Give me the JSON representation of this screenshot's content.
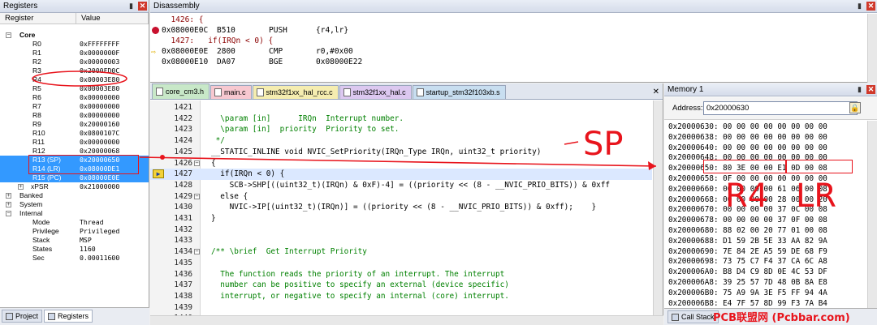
{
  "registers": {
    "title": "Registers",
    "col_register": "Register",
    "col_value": "Value",
    "core_label": "Core",
    "core": [
      {
        "name": "R0",
        "value": "0xFFFFFFFF"
      },
      {
        "name": "R1",
        "value": "0x0000000F"
      },
      {
        "name": "R2",
        "value": "0x00000003"
      },
      {
        "name": "R3",
        "value": "0x2000FD0C"
      },
      {
        "name": "R4",
        "value": "0x00003E80"
      },
      {
        "name": "R5",
        "value": "0x00003E80"
      },
      {
        "name": "R6",
        "value": "0x00000000"
      },
      {
        "name": "R7",
        "value": "0x00000000"
      },
      {
        "name": "R8",
        "value": "0x00000000"
      },
      {
        "name": "R9",
        "value": "0x20000160"
      },
      {
        "name": "R10",
        "value": "0x0800107C"
      },
      {
        "name": "R11",
        "value": "0x00000000"
      },
      {
        "name": "R12",
        "value": "0x20000068"
      },
      {
        "name": "R13 (SP)",
        "value": "0x20000650"
      },
      {
        "name": "R14 (LR)",
        "value": "0x08000DE1"
      },
      {
        "name": "R15 (PC)",
        "value": "0x08000E0E"
      },
      {
        "name": "xPSR",
        "value": "0x21000000"
      }
    ],
    "groups": [
      "Banked",
      "System",
      "Internal"
    ],
    "internal": [
      {
        "name": "Mode",
        "value": "Thread"
      },
      {
        "name": "Privilege",
        "value": "Privileged"
      },
      {
        "name": "Stack",
        "value": "MSP"
      },
      {
        "name": "States",
        "value": "1160"
      },
      {
        "name": "Sec",
        "value": "0.00011600"
      }
    ],
    "bottom_tabs": [
      "Project",
      "Registers"
    ]
  },
  "disassembly": {
    "title": "Disassembly",
    "lines": [
      {
        "src": "  1426: {"
      },
      {
        "addr": "0x08000E0C",
        "code": "B510",
        "mn": "PUSH",
        "ops": "{r4,lr}",
        "bp": true
      },
      {
        "src": "  1427:   if(IRQn < 0) {"
      },
      {
        "addr": "0x08000E0E",
        "code": "2800",
        "mn": "CMP",
        "ops": "r0,#0x00",
        "arrow": true
      },
      {
        "addr": "0x08000E10",
        "code": "DA07",
        "mn": "BGE",
        "ops": "0x08000E22"
      }
    ]
  },
  "editor": {
    "tabs": [
      {
        "label": "core_cm3.h",
        "color": "#c8e8c8",
        "active": true
      },
      {
        "label": "main.c",
        "color": "#f7c8d0"
      },
      {
        "label": "stm32f1xx_hal_rcc.c",
        "color": "#f5edb0"
      },
      {
        "label": "stm32f1xx_hal.c",
        "color": "#dcc8f0"
      },
      {
        "label": "startup_stm32f103xb.s",
        "color": "#c8def0"
      }
    ],
    "lines": [
      {
        "n": "1421",
        "t": ""
      },
      {
        "n": "1422",
        "t": "  \\param [in]      IRQn  Interrupt number.",
        "c": "cmt"
      },
      {
        "n": "1423",
        "t": "  \\param [in]  priority  Priority to set.",
        "c": "cmt"
      },
      {
        "n": "1424",
        "t": " */",
        "c": "cmt"
      },
      {
        "n": "1425",
        "t": "__STATIC_INLINE void NVIC_SetPriority(IRQn_Type IRQn, uint32_t priority)"
      },
      {
        "n": "1426",
        "t": "{",
        "fold": true
      },
      {
        "n": "1427",
        "t": "  if(IRQn < 0) {",
        "cur": true
      },
      {
        "n": "1428",
        "t": "    SCB->SHP[((uint32_t)(IRQn) & 0xF)-4] = ((priority << (8 - __NVIC_PRIO_BITS)) & 0xff"
      },
      {
        "n": "1429",
        "t": "  else {",
        "fold": true
      },
      {
        "n": "1430",
        "t": "    NVIC->IP[(uint32_t)(IRQn)] = ((priority << (8 - __NVIC_PRIO_BITS)) & 0xff);    }"
      },
      {
        "n": "1431",
        "t": "}"
      },
      {
        "n": "1432",
        "t": ""
      },
      {
        "n": "1433",
        "t": ""
      },
      {
        "n": "1434",
        "t": "/** \\brief  Get Interrupt Priority",
        "c": "cmt",
        "fold": true
      },
      {
        "n": "1435",
        "t": ""
      },
      {
        "n": "1436",
        "t": "  The function reads the priority of an interrupt. The interrupt",
        "c": "cmt"
      },
      {
        "n": "1437",
        "t": "  number can be positive to specify an external (device specific)",
        "c": "cmt"
      },
      {
        "n": "1438",
        "t": "  interrupt, or negative to specify an internal (core) interrupt.",
        "c": "cmt"
      },
      {
        "n": "1439",
        "t": ""
      },
      {
        "n": "1440",
        "t": ""
      }
    ]
  },
  "memory": {
    "title": "Memory 1",
    "address_label": "Address:",
    "address_value": "0x20000630",
    "rows": [
      "0x20000630: 00 00 00 00 00 00 00 00",
      "0x20000638: 00 00 00 00 00 00 00 00",
      "0x20000640: 00 00 00 00 00 00 00 00",
      "0x20000648: 00 00 00 00 00 00 00 00",
      "0x20000650: 80 3E 00 00 E1 0D 00 08",
      "0x20000658: 0F 00 00 00 00 00 00 00",
      "0x20000660: 00 00 00 00 61 06 00 08",
      "0x20000668: 00 00 00 00 28 00 00 20",
      "0x20000670: 00 00 00 00 37 0C 00 08",
      "0x20000678: 00 00 00 00 37 0F 00 08",
      "0x20000680: 88 02 00 20 77 01 00 08",
      "0x20000688: D1 59 2B 5E 33 AA 82 9A",
      "0x20000690: 7E 84 2E A5 59 DE 68 F9",
      "0x20000698: 73 75 C7 F4 37 CA 6C A8",
      "0x200006A0: B8 D4 C9 8D 0E 4C 53 DF",
      "0x200006A8: 39 25 57 7D 48 0B 8A E8",
      "0x200006B0: 75 A9 9A 3E F5 FF 94 4A",
      "0x200006B8: E4 7F 57 8D 99 F3 7A B4"
    ],
    "footer_tab": "Call Stack"
  },
  "annotations": {
    "sp": "SP",
    "r4": "R4",
    "lr": "LR",
    "color": "#e8141c"
  },
  "watermark": "PCB联盟网 (Pcbbar.com)"
}
